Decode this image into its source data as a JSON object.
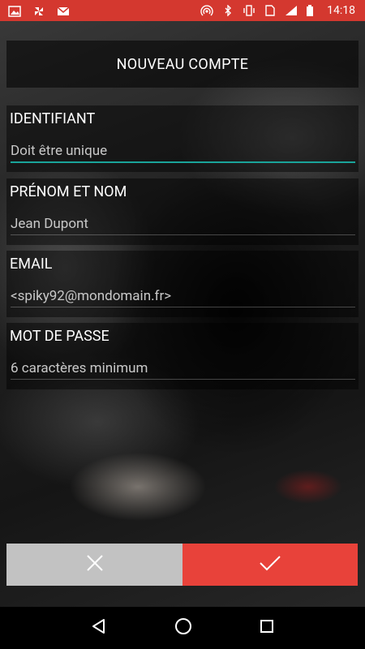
{
  "status_bar": {
    "time": "14:18",
    "left_icons": [
      "image-icon",
      "pinwheel-icon",
      "gmail-icon"
    ],
    "right_icons": [
      "hotspot-icon",
      "bluetooth-icon",
      "vibrate-icon",
      "sim-icon",
      "signal-icon",
      "battery-icon"
    ],
    "color": "#d4382f"
  },
  "header": {
    "title": "NOUVEAU COMPTE"
  },
  "form": {
    "fields": [
      {
        "label": "IDENTIFIANT",
        "placeholder": "Doit être unique"
      },
      {
        "label": "PRÉNOM ET NOM",
        "placeholder": "Jean Dupont"
      },
      {
        "label": "EMAIL",
        "placeholder": "<spiky92@mondomain.fr>"
      },
      {
        "label": "MOT DE PASSE",
        "placeholder": "6 caractères minimum"
      }
    ],
    "accent_color": "#1aa49a"
  },
  "actions": {
    "cancel_icon": "close-icon",
    "confirm_icon": "checkmark-icon",
    "cancel_color": "#c2c2c2",
    "confirm_color": "#e8423a"
  },
  "navbar": {
    "icons": [
      "back-icon",
      "home-icon",
      "recents-icon"
    ]
  }
}
